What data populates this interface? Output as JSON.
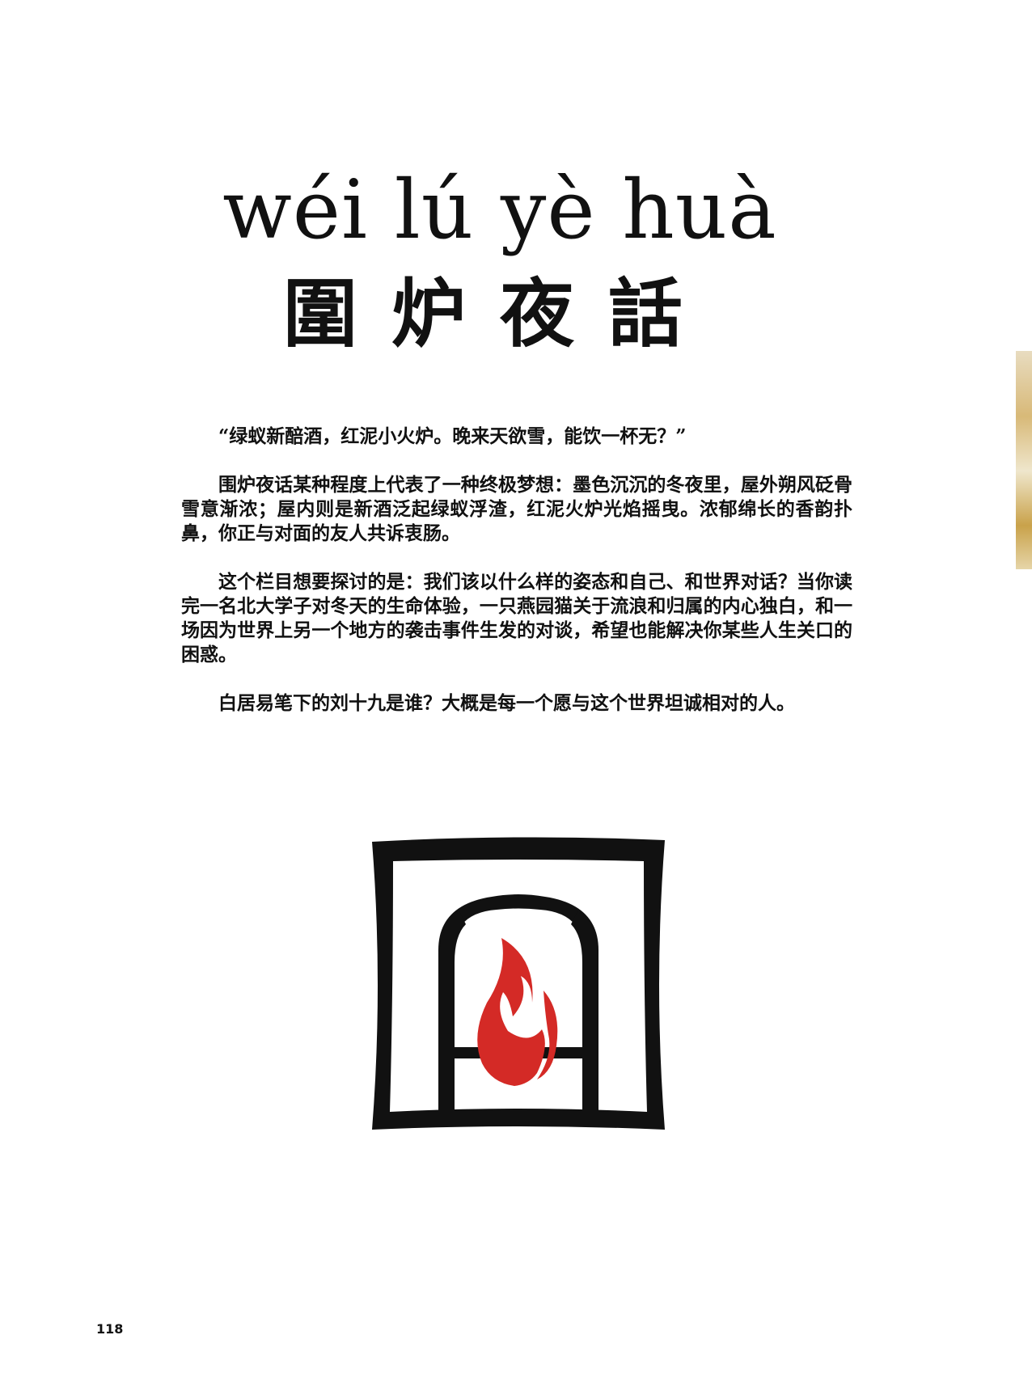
{
  "header": {
    "pinyin": "wéi lú yè huà",
    "title": "圍炉夜話"
  },
  "body": {
    "paragraphs": [
      "“绿蚁新醅酒，红泥小火炉。晚来天欲雪，能饮一杯无？”",
      "围炉夜话某种程度上代表了一种终极梦想：墨色沉沉的冬夜里，屋外朔风砭骨雪意渐浓；屋内则是新酒泛起绿蚁浮渣，红泥火炉光焰摇曳。浓郁绵长的香韵扑鼻，你正与对面的友人共诉衷肠。",
      "这个栏目想要探讨的是：我们该以什么样的姿态和自己、和世界对话？当你读完一名北大学子对冬天的生命体验，一只燕园猫关于流浪和归属的内心独白，和一场因为世界上另一个地方的袭击事件生发的对谈，希望也能解决你某些人生关口的困惑。",
      "白居易笔下的刘十九是谁？大概是每一个愿与这个世界坦诚相对的人。"
    ]
  },
  "footer": {
    "page_number": "118"
  },
  "colors": {
    "ink": "#111111",
    "flame": "#d42a26",
    "background": "#ffffff"
  },
  "icons": {
    "logo": "fireplace-flame-icon"
  }
}
